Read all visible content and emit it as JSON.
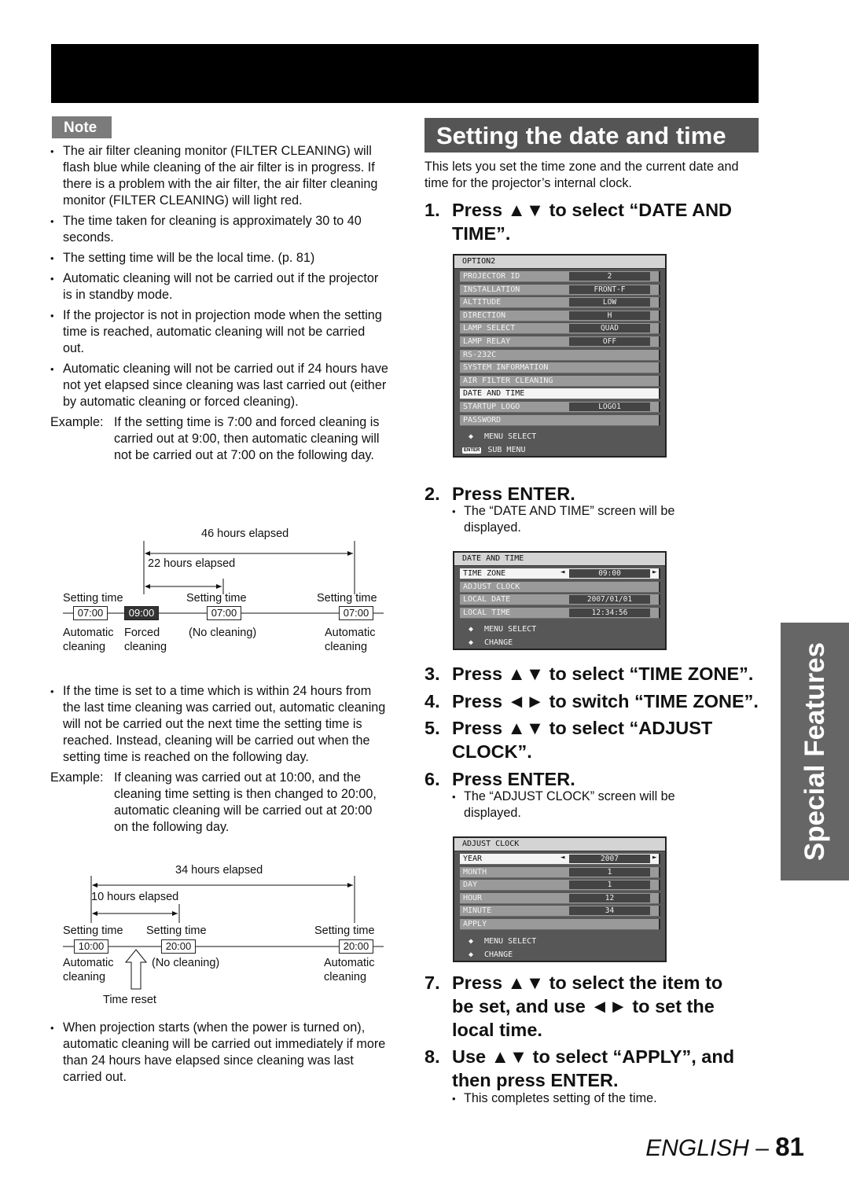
{
  "note": {
    "label": "Note",
    "bullets": [
      "The air filter cleaning monitor (FILTER CLEANING) will flash blue while cleaning of the air filter is in progress. If there is a problem with the air filter, the air filter cleaning monitor (FILTER CLEANING) will light red.",
      "The time taken for cleaning is approximately 30 to 40 seconds.",
      "The setting time will be the local time. (p. 81)",
      "Automatic cleaning will not be carried out if the projector is in standby mode.",
      "If the projector is not in projection mode when the setting time is reached, automatic cleaning will not be carried out.",
      "Automatic cleaning will not be carried out if 24 hours have not yet elapsed since cleaning was last carried out (either by automatic cleaning or forced cleaning)."
    ],
    "example1": {
      "label": "Example:",
      "text": "If the setting time is 7:00 and forced cleaning is carried out at 9:00, then automatic cleaning will not be carried out at 7:00 on the following day."
    },
    "diagram1": {
      "span_long": "46 hours elapsed",
      "span_short": "22 hours elapsed",
      "setting_time": "Setting time",
      "times": [
        "07:00",
        "09:00",
        "07:00",
        "07:00"
      ],
      "captions": [
        "Automatic\ncleaning",
        "Forced\ncleaning",
        "(No cleaning)",
        "Automatic\ncleaning"
      ]
    },
    "bullet_after": "If the time is set to a time which is within 24 hours from the last time cleaning was carried out, automatic cleaning will not be carried out the next time the setting time is reached. Instead, cleaning will be carried out when the setting time is reached on the following day.",
    "example2": {
      "label": "Example:",
      "text": "If cleaning was carried out at 10:00, and the cleaning time setting is then changed to 20:00, automatic cleaning will be carried out at 20:00 on the following day."
    },
    "diagram2": {
      "span_long": "34 hours elapsed",
      "span_short": "10 hours elapsed",
      "setting_time": "Setting time",
      "times": [
        "10:00",
        "20:00",
        "20:00"
      ],
      "captions": [
        "Automatic\ncleaning",
        "(No cleaning)",
        "Automatic\ncleaning"
      ],
      "reset_label": "Time reset"
    },
    "bullet_last": "When projection starts (when the power is turned on), automatic cleaning will be carried out immediately if more than 24 hours have elapsed since cleaning was last carried out."
  },
  "section": {
    "title": "Setting the date and time",
    "intro": "This lets you set the time zone and the current date and time for the projector’s internal clock.",
    "steps": [
      {
        "num": "1.",
        "text": "Press ▲▼ to select “DATE AND TIME”."
      },
      {
        "num": "2.",
        "text": "Press ENTER.",
        "note": "The “DATE AND TIME” screen will be displayed."
      },
      {
        "num": "3.",
        "text": "Press ▲▼ to select “TIME ZONE”."
      },
      {
        "num": "4.",
        "text": "Press ◄► to switch “TIME ZONE”."
      },
      {
        "num": "5.",
        "text": "Press ▲▼ to select “ADJUST CLOCK”."
      },
      {
        "num": "6.",
        "text": "Press ENTER.",
        "note": "The “ADJUST CLOCK” screen will be displayed."
      },
      {
        "num": "7.",
        "text": "Press ▲▼ to select the item to be set, and use ◄► to set the local time."
      },
      {
        "num": "8.",
        "text": "Use ▲▼ to select “APPLY”, and then press ENTER.",
        "note": "This completes setting of the time."
      }
    ]
  },
  "osd_option2": {
    "title": "OPTION2",
    "rows": [
      {
        "label": "PROJECTOR ID",
        "value": "2"
      },
      {
        "label": "INSTALLATION",
        "value": "FRONT-F"
      },
      {
        "label": "ALTITUDE",
        "value": "LOW"
      },
      {
        "label": "DIRECTION",
        "value": "H"
      },
      {
        "label": "LAMP SELECT",
        "value": "QUAD"
      },
      {
        "label": "LAMP RELAY",
        "value": "OFF"
      },
      {
        "label": "RS-232C",
        "value": null
      },
      {
        "label": "SYSTEM INFORMATION",
        "value": null
      },
      {
        "label": "AIR FILTER CLEANING",
        "value": null
      },
      {
        "label": "DATE AND TIME",
        "value": null,
        "selected": true
      },
      {
        "label": "STARTUP LOGO",
        "value": "LOGO1"
      },
      {
        "label": "PASSWORD",
        "value": null
      }
    ],
    "footer": [
      {
        "icon": "up-down-icon",
        "glyph": "⬍",
        "label": "MENU SELECT"
      },
      {
        "icon": "enter-icon",
        "glyph": "ENTER",
        "label": "SUB MENU"
      }
    ]
  },
  "osd_datetime": {
    "title": "DATE AND TIME",
    "rows": [
      {
        "label": "TIME ZONE",
        "value": "09:00",
        "selected": true,
        "arrows": true
      },
      {
        "label": "ADJUST CLOCK",
        "value": null
      },
      {
        "label": "LOCAL DATE",
        "value": "2007/01/01"
      },
      {
        "label": "LOCAL TIME",
        "value": "12:34:56"
      }
    ],
    "footer": [
      {
        "icon": "up-down-icon",
        "glyph": "⬍",
        "label": "MENU SELECT"
      },
      {
        "icon": "left-right-icon",
        "glyph": "⬌",
        "label": "CHANGE"
      }
    ]
  },
  "osd_adjust": {
    "title": "ADJUST CLOCK",
    "rows": [
      {
        "label": "YEAR",
        "value": "2007",
        "selected": true,
        "arrows": true
      },
      {
        "label": "MONTH",
        "value": "1"
      },
      {
        "label": "DAY",
        "value": "1"
      },
      {
        "label": "HOUR",
        "value": "12"
      },
      {
        "label": "MINUTE",
        "value": "34"
      },
      {
        "label": "APPLY",
        "value": null
      }
    ],
    "footer": [
      {
        "icon": "up-down-icon",
        "glyph": "⬍",
        "label": "MENU SELECT"
      },
      {
        "icon": "left-right-icon",
        "glyph": "⬌",
        "label": "CHANGE"
      }
    ]
  },
  "side_tab": "Special Features",
  "footer": {
    "language": "ENGLISH",
    "dash": " – ",
    "page": "81"
  }
}
